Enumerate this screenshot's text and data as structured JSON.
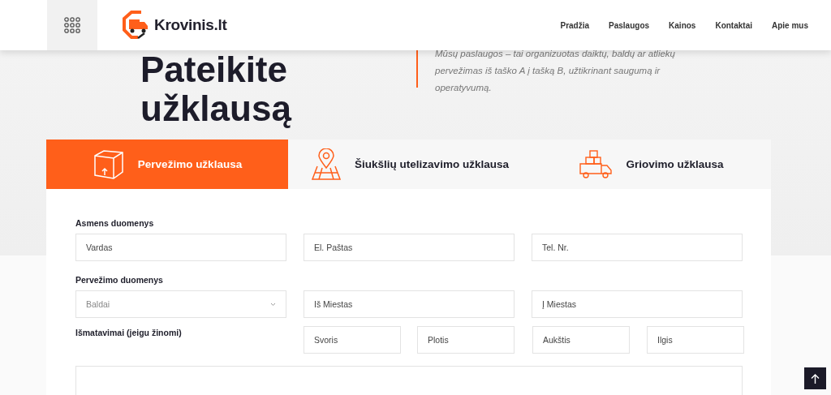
{
  "header": {
    "logo_text": "Krovinis.lt",
    "nav": [
      {
        "label": "Pradžia"
      },
      {
        "label": "Paslaugos"
      },
      {
        "label": "Kainos"
      },
      {
        "label": "Kontaktai"
      },
      {
        "label": "Apie mus"
      }
    ]
  },
  "hero": {
    "title_lines": [
      "Pateikite",
      "užklausą"
    ],
    "description": "Mūsų paslaugos – tai organizuotas daiktų, baldų ar atliekų pervežimas iš taško A į tašką B, užtikrinant saugumą ir operatyvumą."
  },
  "tabs": [
    {
      "label": "Pervežimo užklausa",
      "kind": "box",
      "selected": true
    },
    {
      "label": "Šiukšlių utelizavimo užklausa",
      "kind": "map",
      "selected": false
    },
    {
      "label": "Griovimo užklausa",
      "kind": "truck",
      "selected": false
    }
  ],
  "form": {
    "sections": [
      {
        "title": "Asmens duomenys",
        "kind": "wide",
        "fields": [
          {
            "kind": "input",
            "placeholder": "Vardas"
          },
          {
            "kind": "input",
            "placeholder": "El. Paštas"
          },
          {
            "kind": "input",
            "placeholder": "Tel. Nr."
          }
        ]
      },
      {
        "title": "Pervežimo duomenys",
        "kind": "wide",
        "fields": [
          {
            "kind": "select",
            "value": "Baldai"
          },
          {
            "kind": "input",
            "placeholder": "Iš Miestas"
          },
          {
            "kind": "input",
            "placeholder": "Į Miestas"
          }
        ]
      },
      {
        "title": "Išmatavimai (jeigu žinomi)",
        "kind": "narrow",
        "fields": [
          {
            "kind": "input",
            "placeholder": "Svoris"
          },
          {
            "kind": "input",
            "placeholder": "Plotis"
          },
          {
            "kind": "input",
            "placeholder": "Aukštis"
          },
          {
            "kind": "input",
            "placeholder": "Ilgis"
          }
        ]
      }
    ]
  }
}
